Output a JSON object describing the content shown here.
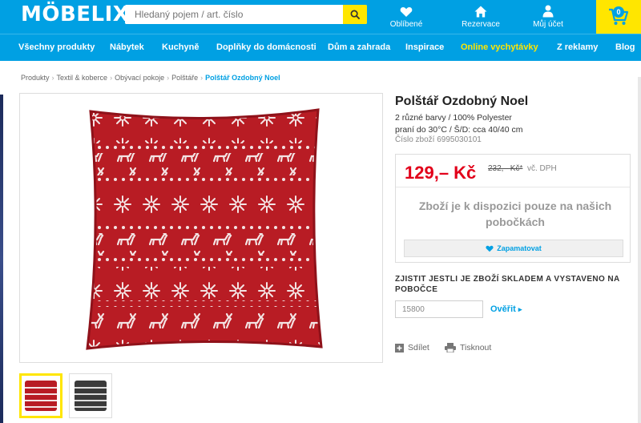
{
  "header": {
    "logo": "MÖBELIX",
    "search_placeholder": "Hledaný pojem / art. číslo",
    "links": [
      {
        "label": "Oblíbené",
        "icon": "heart-icon"
      },
      {
        "label": "Rezervace",
        "icon": "home-icon"
      },
      {
        "label": "Můj účet",
        "icon": "user-icon"
      }
    ],
    "cart_count": "0"
  },
  "nav": [
    "Všechny produkty",
    "Nábytek",
    "Kuchyně",
    "Doplňky do domácnosti",
    "Dům a zahrada",
    "Inspirace",
    "Online vychytávky",
    "Z reklamy",
    "Blog"
  ],
  "breadcrumb": {
    "items": [
      "Produkty",
      "Textil & koberce",
      "Obývací pokoje",
      "Polštáře"
    ],
    "current": "Polštář Ozdobný Noel"
  },
  "product": {
    "title": "Polštář Ozdobný Noel",
    "desc_line1": "2 různé barvy / 100% Polyester",
    "desc_line2": "praní do 30°C / Š/D: cca 40/40 cm",
    "code": "Číslo zboží 6995030101",
    "price": "129,– Kč",
    "old_price": "232,– Kč*",
    "vat": "vč. DPH",
    "availability": "Zboží je k dispozici pouze na našich pobočkách",
    "remember": "Zapamatovat",
    "check_title": "ZJISTIT JESTLI JE ZBOŽÍ SKLADEM A VYSTAVENO NA POBOČCE",
    "zip_value": "15800",
    "verify": "Ověřit",
    "share": "Sdílet",
    "print": "Tisknout"
  },
  "colors": {
    "brand_blue": "#00a0e3",
    "accent_yellow": "#ffe600",
    "price_red": "#e2001a",
    "pillow_red": "#b81c24",
    "pillow_grey": "#3a3a3a"
  }
}
